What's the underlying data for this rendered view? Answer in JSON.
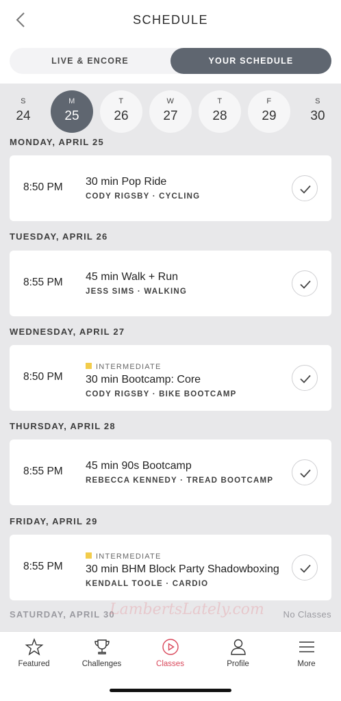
{
  "header": {
    "title": "SCHEDULE"
  },
  "segments": {
    "left": "LIVE & ENCORE",
    "right": "YOUR SCHEDULE"
  },
  "week": [
    {
      "letter": "S",
      "num": "24"
    },
    {
      "letter": "M",
      "num": "25"
    },
    {
      "letter": "T",
      "num": "26"
    },
    {
      "letter": "W",
      "num": "27"
    },
    {
      "letter": "T",
      "num": "28"
    },
    {
      "letter": "F",
      "num": "29"
    },
    {
      "letter": "S",
      "num": "30"
    }
  ],
  "days": [
    {
      "heading": "MONDAY, APRIL 25",
      "time": "8:50 PM",
      "title": "30 min Pop Ride",
      "instructor": "CODY RIGSBY",
      "category": "CYCLING",
      "level": ""
    },
    {
      "heading": "TUESDAY, APRIL 26",
      "time": "8:55 PM",
      "title": "45 min Walk + Run",
      "instructor": "JESS SIMS",
      "category": "WALKING",
      "level": ""
    },
    {
      "heading": "WEDNESDAY, APRIL 27",
      "time": "8:50 PM",
      "title": "30 min Bootcamp: Core",
      "instructor": "CODY RIGSBY",
      "category": "BIKE BOOTCAMP",
      "level": "INTERMEDIATE"
    },
    {
      "heading": "THURSDAY, APRIL 28",
      "time": "8:55 PM",
      "title": "45 min 90s Bootcamp",
      "instructor": "REBECCA KENNEDY",
      "category": "TREAD BOOTCAMP",
      "level": ""
    },
    {
      "heading": "FRIDAY, APRIL 29",
      "time": "8:55 PM",
      "title": "30 min BHM Block Party Shadowboxing",
      "instructor": "KENDALL TOOLE",
      "category": "CARDIO",
      "level": "INTERMEDIATE"
    }
  ],
  "saturday": {
    "heading": "SATURDAY, APRIL 30",
    "status": "No Classes"
  },
  "separator": " · ",
  "watermark": "LambertsLately.com",
  "tabs": [
    {
      "label": "Featured",
      "icon": "star-icon"
    },
    {
      "label": "Challenges",
      "icon": "trophy-icon"
    },
    {
      "label": "Classes",
      "icon": "play-circle-icon"
    },
    {
      "label": "Profile",
      "icon": "person-icon"
    },
    {
      "label": "More",
      "icon": "menu-icon"
    }
  ],
  "colors": {
    "accent": "#d9475a",
    "selected": "#5f6670",
    "level": "#f2cc4b"
  }
}
